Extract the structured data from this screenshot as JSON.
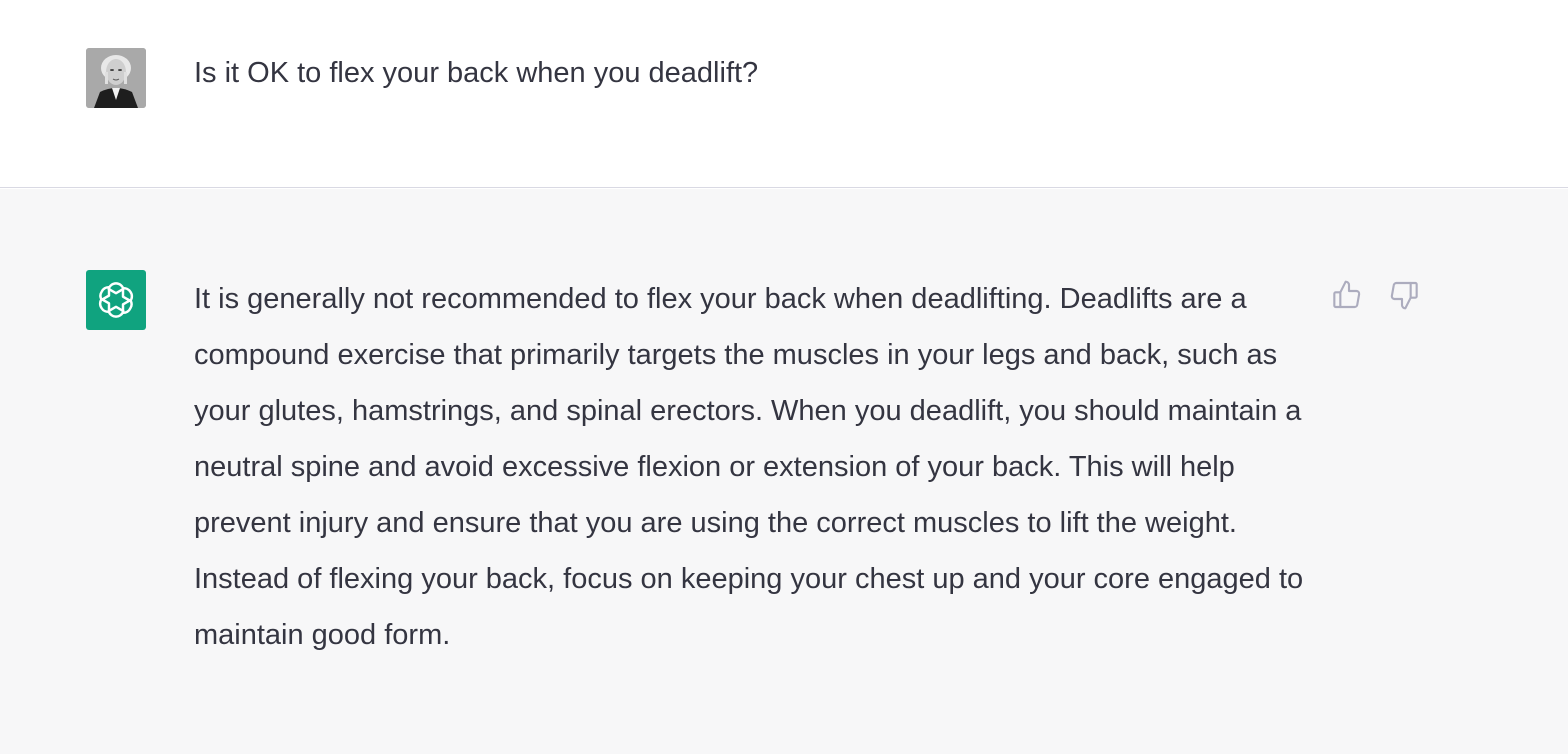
{
  "user_message": {
    "text": "Is it OK to flex your back when you deadlift?",
    "avatar_icon": "user-portrait-avatar"
  },
  "assistant_message": {
    "avatar_icon": "openai-logo-icon",
    "avatar_color": "#10a37f",
    "text": "It is generally not recommended to flex your back when deadlifting. Deadlifts are a compound exercise that primarily targets the muscles in your legs and back, such as your glutes, hamstrings, and spinal erectors. When you deadlift, you should maintain a neutral spine and avoid excessive flexion or extension of your back. This will help prevent injury and ensure that you are using the correct muscles to lift the weight. Instead of flexing your back, focus on keeping your chest up and your core engaged to maintain good form.",
    "feedback": {
      "up_icon": "thumbs-up-icon",
      "down_icon": "thumbs-down-icon"
    }
  },
  "colors": {
    "text": "#343541",
    "assistant_bg": "#f7f7f8",
    "user_bg": "#ffffff",
    "icon_gray": "#acacbe"
  }
}
